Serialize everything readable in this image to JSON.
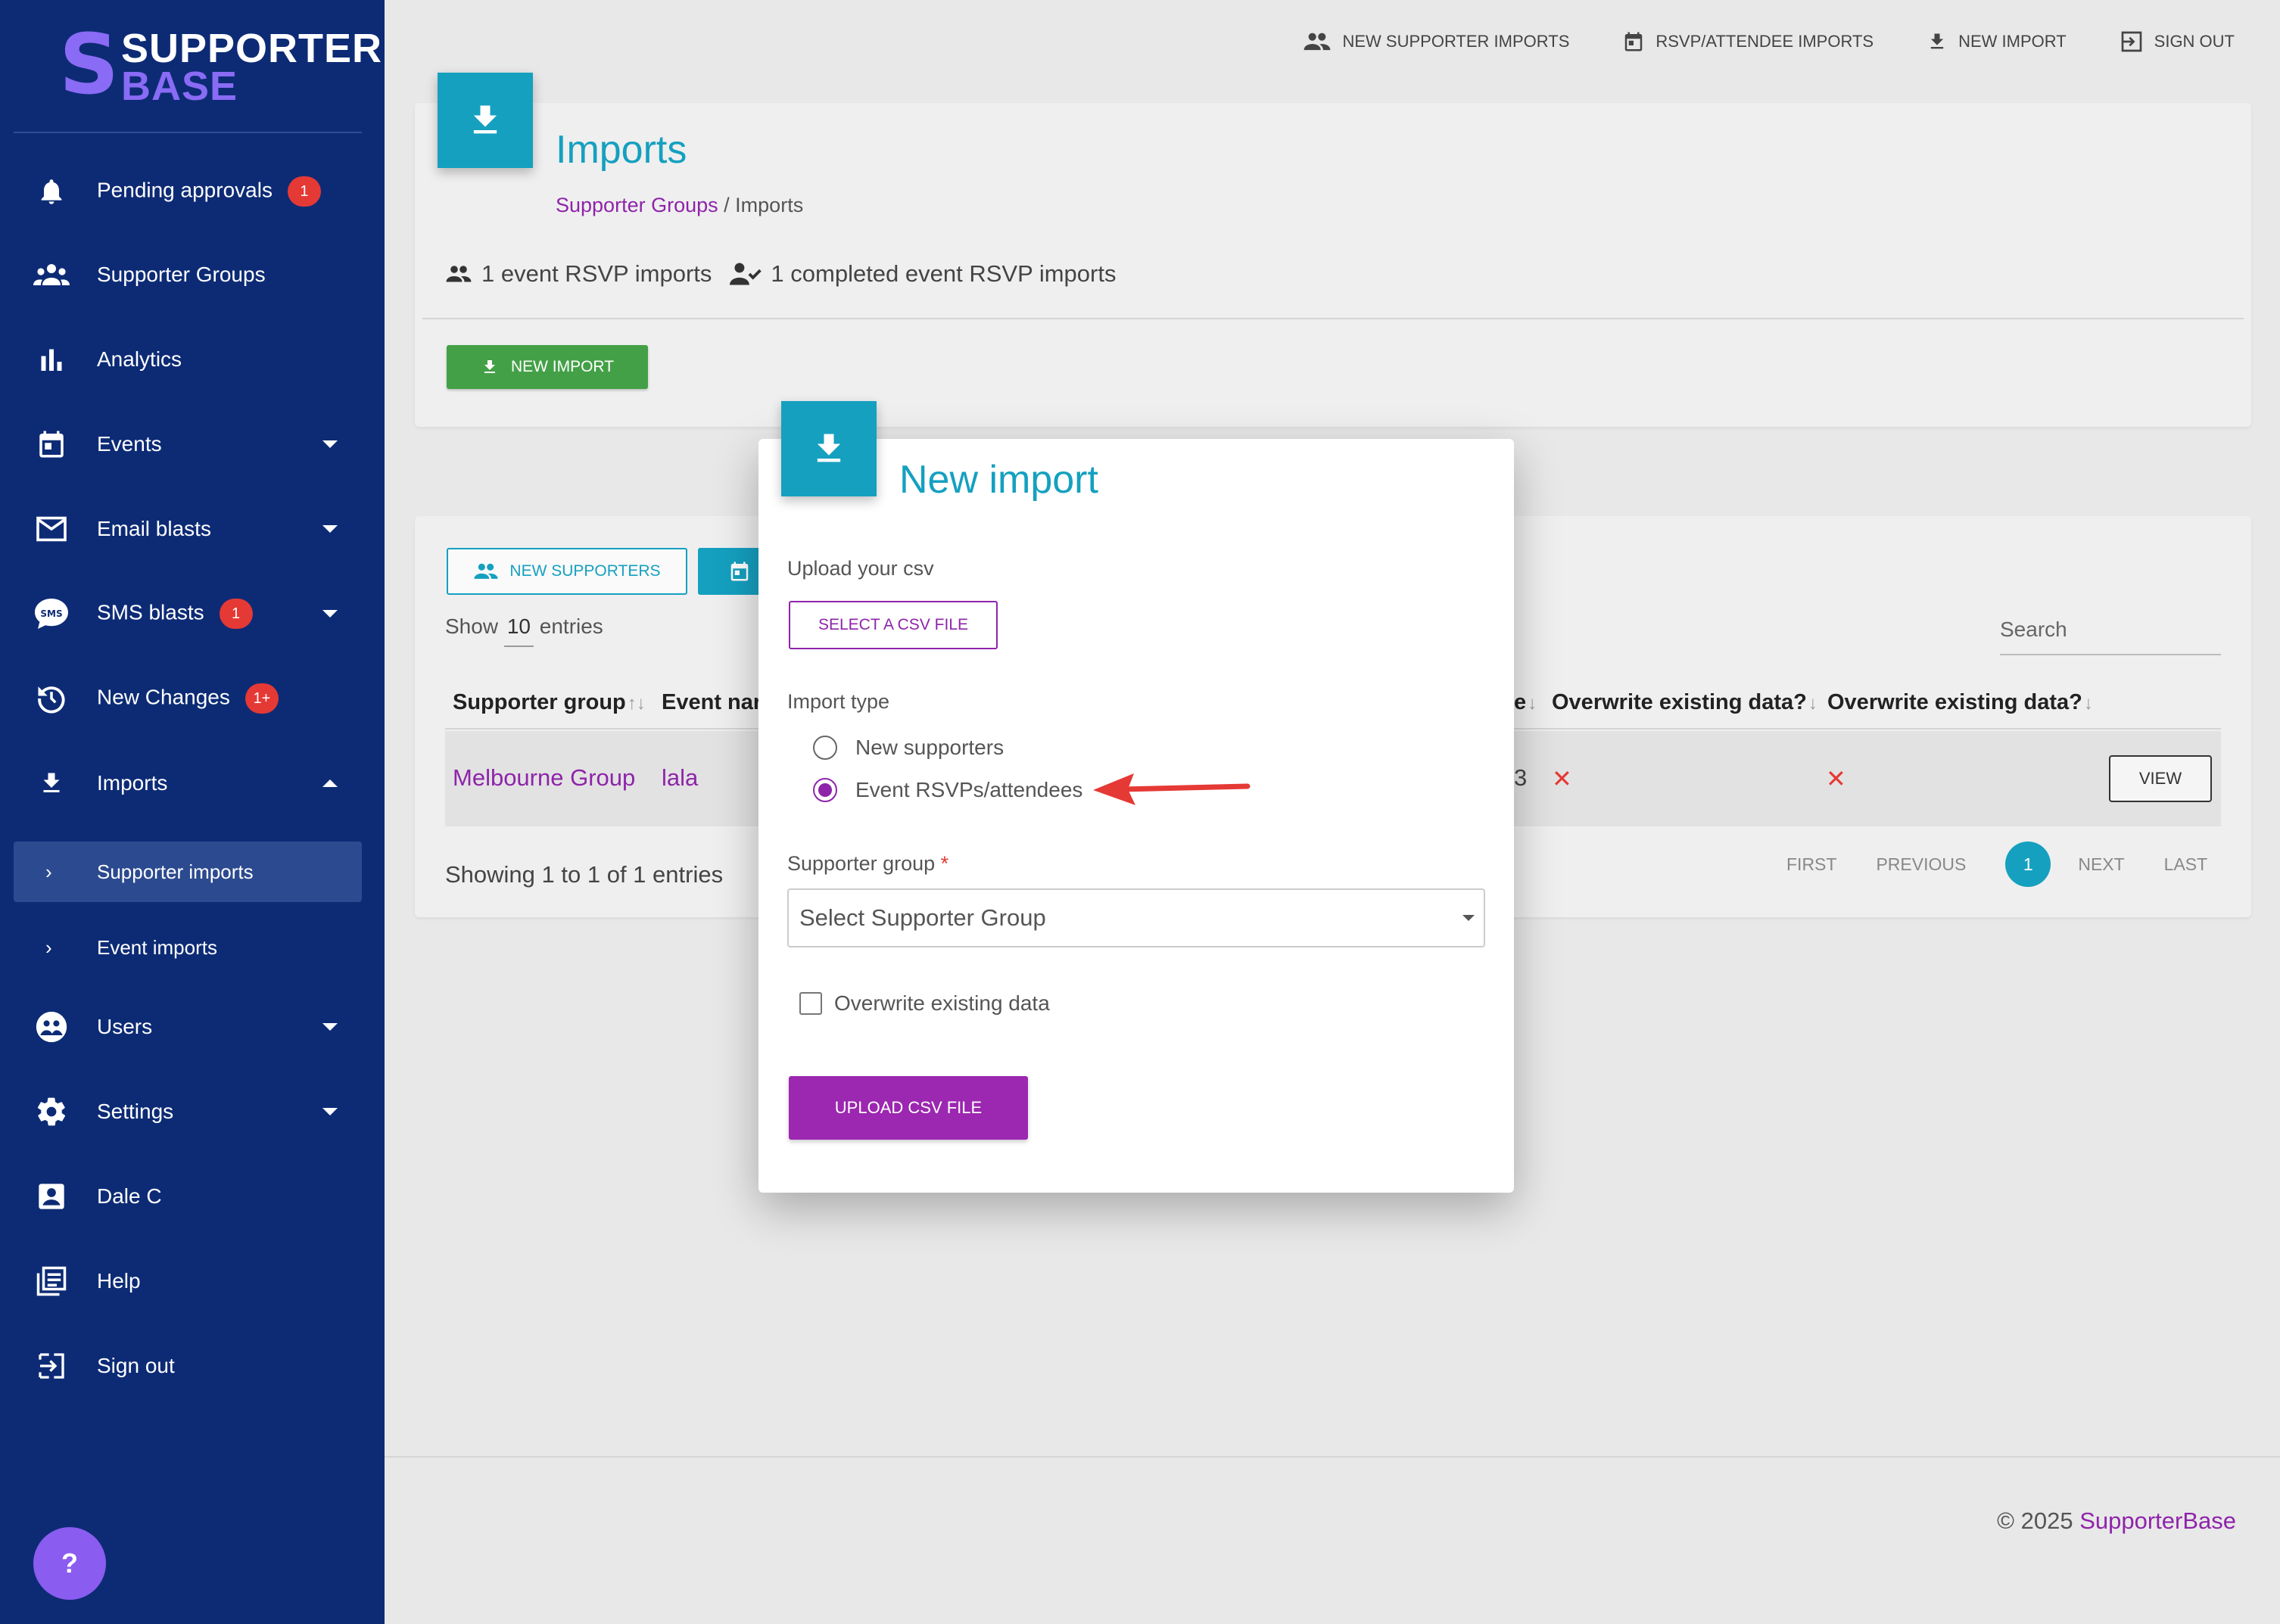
{
  "sidebar": {
    "logo_line1": "SUPPORTER",
    "logo_line2": "BASE",
    "items": [
      {
        "label": "Pending approvals",
        "badge": "1",
        "icon": "bell-icon"
      },
      {
        "label": "Supporter Groups",
        "icon": "groups-icon"
      },
      {
        "label": "Analytics",
        "icon": "bar-chart-icon"
      },
      {
        "label": "Events",
        "icon": "calendar-icon"
      },
      {
        "label": "Email blasts",
        "icon": "mail-icon"
      },
      {
        "label": "SMS blasts",
        "badge": "1",
        "icon": "sms-icon"
      },
      {
        "label": "New Changes",
        "badge": "1+",
        "icon": "history-icon"
      },
      {
        "label": "Imports",
        "icon": "download-icon"
      },
      {
        "label": "Users",
        "icon": "users-icon"
      },
      {
        "label": "Settings",
        "icon": "gear-icon"
      },
      {
        "label": "Dale C",
        "icon": "account-box-icon"
      },
      {
        "label": "Help",
        "icon": "help-book-icon"
      },
      {
        "label": "Sign out",
        "icon": "logout-icon"
      }
    ],
    "sub_items": [
      {
        "label": "Supporter imports",
        "active": true
      },
      {
        "label": "Event imports",
        "active": false
      }
    ],
    "help_fab": "?"
  },
  "topnav": {
    "items": [
      {
        "label": "NEW SUPPORTER IMPORTS",
        "icon": "people-icon"
      },
      {
        "label": "RSVP/ATTENDEE IMPORTS",
        "icon": "calendar-icon"
      },
      {
        "label": "NEW IMPORT",
        "icon": "download-icon"
      },
      {
        "label": "SIGN OUT",
        "icon": "logout-icon"
      }
    ]
  },
  "header": {
    "title": "Imports",
    "breadcrumb_link": "Supporter Groups",
    "breadcrumb_sep": "/",
    "breadcrumb_current": "Imports",
    "stat1": "1 event RSVP imports",
    "stat2": "1 completed event RSVP imports",
    "new_import_label": "NEW IMPORT"
  },
  "table": {
    "new_supporters_label": "NEW SUPPORTERS",
    "show_prefix": "Show",
    "show_count": "10",
    "show_suffix": "entries",
    "search_placeholder": "Search",
    "headers": {
      "supporter_group": "Supporter group",
      "event_name": "Event nar",
      "partial": "e",
      "overwrite1": "Overwrite existing data?",
      "overwrite2": "Overwrite existing data?"
    },
    "row": {
      "supporter_group": "Melbourne Group",
      "event_name": "lala",
      "partial": "3",
      "overwrite1": "✕",
      "overwrite2": "✕",
      "view_label": "VIEW"
    },
    "showing": "Showing 1 to 1 of 1 entries",
    "pager": {
      "first": "FIRST",
      "previous": "PREVIOUS",
      "current": "1",
      "next": "NEXT",
      "last": "LAST"
    }
  },
  "footer": {
    "copyright": "© 2025 ",
    "brand": "SupporterBase"
  },
  "modal": {
    "title": "New import",
    "upload_label": "Upload your csv",
    "select_csv_label": "SELECT A CSV FILE",
    "import_type_label": "Import type",
    "options": [
      {
        "label": "New supporters",
        "checked": false
      },
      {
        "label": "Event RSVPs/attendees",
        "checked": true
      }
    ],
    "supporter_group_label": "Supporter group",
    "required_mark": "*",
    "select_placeholder": "Select Supporter Group",
    "overwrite_label": "Overwrite existing data",
    "upload_button": "UPLOAD CSV FILE"
  },
  "colors": {
    "sidebar_bg": "#0d2b75",
    "accent_teal": "#15a0c0",
    "accent_purple": "#9c27b0",
    "success_green": "#43a047",
    "badge_red": "#e53935",
    "annotation_arrow": "#e53935"
  }
}
